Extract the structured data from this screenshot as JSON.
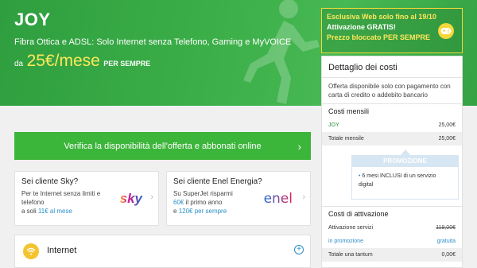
{
  "hero": {
    "title": "JOY",
    "subtitle": "Fibra Ottica e ADSL: Solo Internet senza Telefono, Gaming e MyVOICE",
    "price_prefix": "da",
    "price": "25€/mese",
    "price_suffix": "PER SEMPRE"
  },
  "promo": {
    "line1": "Esclusiva Web solo fino al 19/10",
    "line2": "Attivazione GRATIS!",
    "line3": "Prezzo bloccato PER SEMPRE",
    "icon": "gamepad-icon"
  },
  "verify_button": "Verifica la disponibilità dell'offerta e abbonati online",
  "cards": {
    "sky": {
      "title": "Sei cliente Sky?",
      "line1": "Per te Internet senza limiti e telefono",
      "line2_prefix": "a soli",
      "line2_price": "11€ al mese",
      "logo": "sky"
    },
    "enel": {
      "title": "Sei cliente Enel Energia?",
      "line1_prefix": "Su",
      "line1_brand": "SuperJet",
      "line1_suffix": "risparmi",
      "line2_amount": "60€",
      "line2_text": "il primo anno",
      "line3_prefix": "e",
      "line3_amount": "120€ per sempre",
      "logo": "enel"
    }
  },
  "section_internet": "Internet",
  "costs": {
    "title": "Dettaglio dei costi",
    "note": "Offerta disponibile solo con pagamento con carta di credito o addebito bancario",
    "monthly_title": "Costi mensili",
    "monthly_rows": [
      {
        "label": "JOY",
        "value": "25,00€"
      },
      {
        "label": "Totale mensile",
        "value": "25,00€"
      }
    ],
    "promo_title": "PROMOZIONE",
    "promo_text": "6 mesi INCLUSI di un servizio digital",
    "activation_title": "Costi di attivazione",
    "activation_rows": [
      {
        "label": "Attivazione servizi",
        "value": "119,00€"
      },
      {
        "label": "in promozione",
        "value": "gratuita"
      },
      {
        "label": "Totale una tantum",
        "value": "0,00€"
      }
    ]
  },
  "colors": {
    "green": "#3cb53b",
    "yellow": "#ffe85a",
    "blue": "#2a8fc9"
  }
}
